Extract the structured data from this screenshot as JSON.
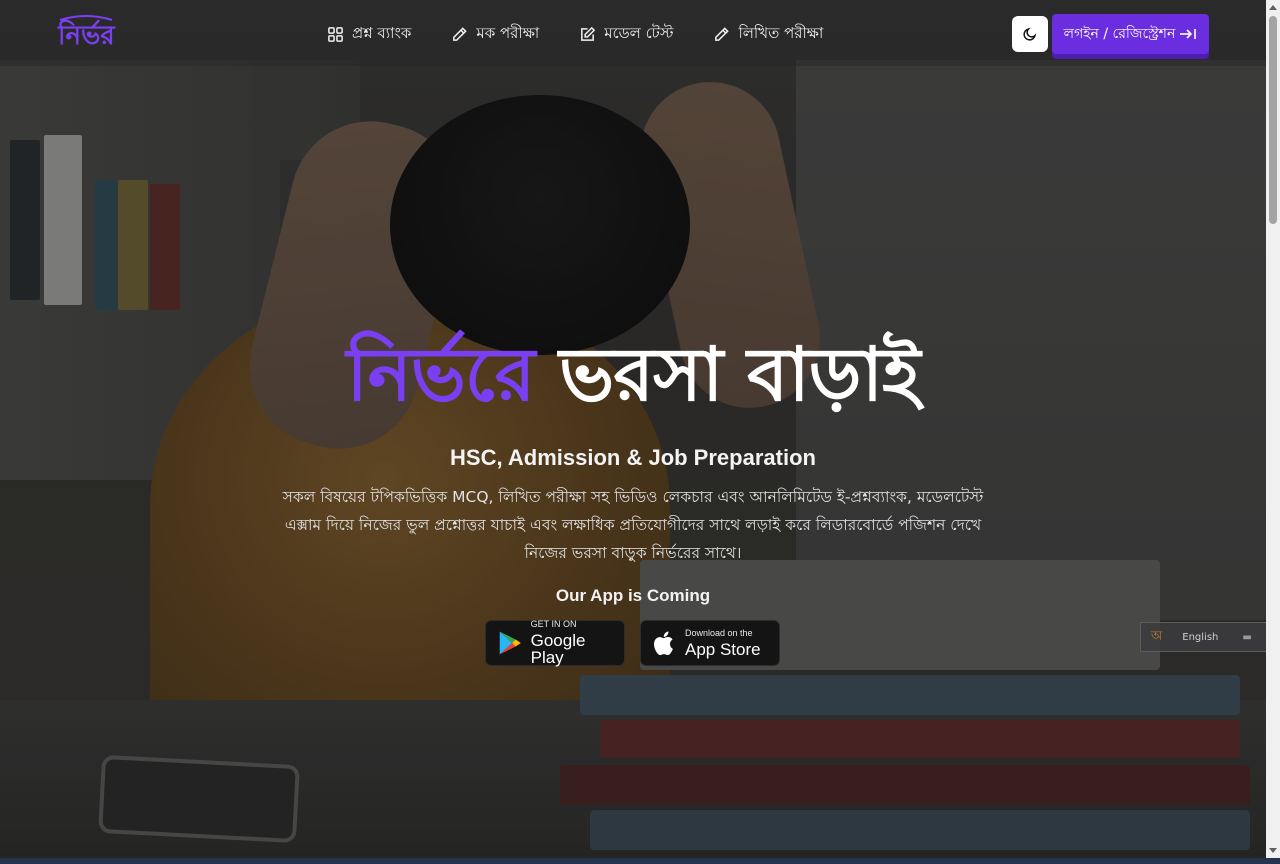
{
  "brand": {
    "logo_text": "নির্ভর",
    "accent_color": "#6a2ee0"
  },
  "nav": {
    "items": [
      {
        "label": "প্রশ্ন ব্যাংক",
        "icon": "grid-icon"
      },
      {
        "label": "মক পরীক্ষা",
        "icon": "pencil-icon"
      },
      {
        "label": "মডেল টেস্ট",
        "icon": "edit-square-icon"
      },
      {
        "label": "লিখিত পরীক্ষা",
        "icon": "pencil-icon"
      }
    ],
    "theme_toggle_icon": "moon-icon",
    "login_label": "লগইন / রেজিস্ট্রেশন",
    "login_icon": "arrow-right-to-line-icon"
  },
  "hero": {
    "title_accent": "নির্ভরে",
    "title_rest": "ভরসা বাড়াই",
    "subtitle": "HSC, Admission & Job Preparation",
    "description": "সকল বিষয়ের টপিকভিত্তিক MCQ, লিখিত পরীক্ষা সহ ভিডিও লেকচার এবং আনলিমিটেড ই-প্রশ্নব্যাংক, মডেলটেস্ট এক্সাম দিয়ে নিজের ভুল প্রশ্নোত্তর যাচাই এবং লক্ষাধিক প্রতিযোগীদের সাথে লড়াই করে লিডারবোর্ডে পজিশন দেখে নিজের ভরসা বাড়ুক নির্ভরের সাথে।",
    "app_coming": "Our App is Coming",
    "google_play": {
      "small": "GET IN ON",
      "big": "Google Play"
    },
    "app_store": {
      "small": "Download on the",
      "big": "App Store"
    }
  },
  "language_widget": {
    "bn_label": "অ",
    "en_label": "English"
  }
}
